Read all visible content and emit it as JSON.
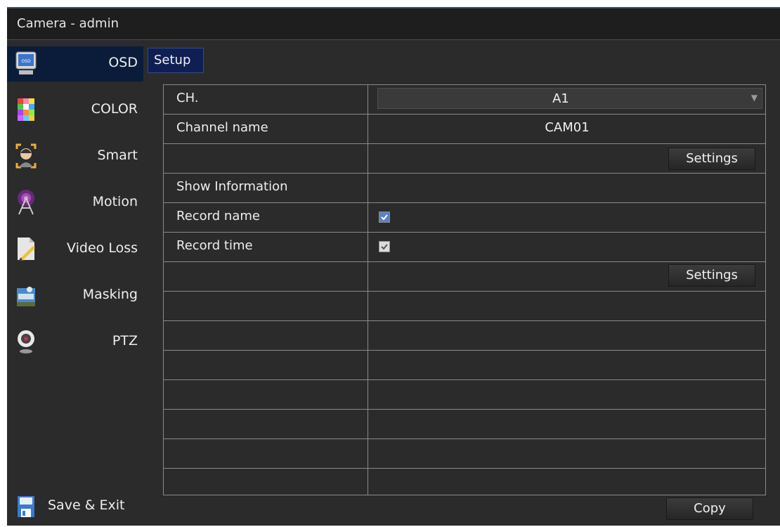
{
  "window": {
    "title": "Camera - admin"
  },
  "sidebar": {
    "items": [
      {
        "label": "OSD",
        "icon": "monitor-icon",
        "active": true
      },
      {
        "label": "COLOR",
        "icon": "color-palette-icon"
      },
      {
        "label": "Smart",
        "icon": "face-detect-icon"
      },
      {
        "label": "Motion",
        "icon": "radio-tower-icon"
      },
      {
        "label": "Video Loss",
        "icon": "document-loss-icon"
      },
      {
        "label": "Masking",
        "icon": "masking-icon"
      },
      {
        "label": "PTZ",
        "icon": "webcam-icon"
      }
    ],
    "save_exit": {
      "label": "Save & Exit",
      "icon": "floppy-disk-icon"
    }
  },
  "tabs": {
    "setup": "Setup"
  },
  "table": {
    "channel": {
      "label": "CH.",
      "value": "A1"
    },
    "channel_name": {
      "label": "Channel name",
      "value": "CAM01"
    },
    "settings_1": "Settings",
    "show_information": "Show Information",
    "record_name": {
      "label": "Record name",
      "checked": true
    },
    "record_time": {
      "label": "Record time",
      "checked": true
    },
    "settings_2": "Settings"
  },
  "footer": {
    "copy_button": "Copy"
  },
  "colors": {
    "background": "#2b2b2b",
    "active_tab": "#0f1f54",
    "checkbox_selected": "#5b82c4"
  }
}
